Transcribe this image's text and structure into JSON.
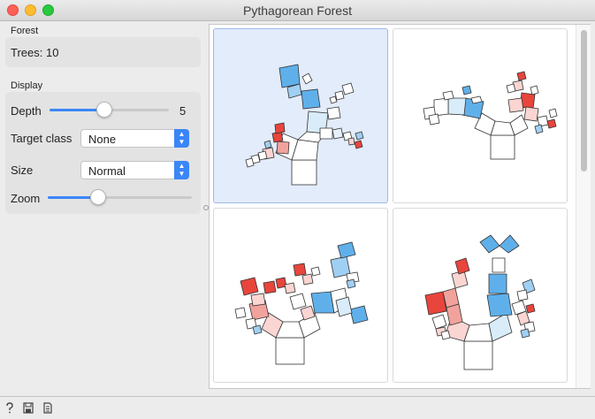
{
  "window": {
    "title": "Pythagorean Forest"
  },
  "forest": {
    "section_label": "Forest",
    "trees_text": "Trees: 10"
  },
  "display": {
    "section_label": "Display",
    "depth": {
      "label": "Depth",
      "value": "5",
      "fraction": 0.5
    },
    "target_class": {
      "label": "Target class",
      "selected": "None"
    },
    "size": {
      "label": "Size",
      "selected": "Normal"
    },
    "zoom": {
      "label": "Zoom",
      "fraction": 0.35
    }
  },
  "trees": [
    {
      "selected": true
    },
    {
      "selected": false
    },
    {
      "selected": false
    },
    {
      "selected": false
    }
  ],
  "statusbar": {
    "icons": [
      "help-icon",
      "save-icon",
      "report-icon"
    ]
  },
  "colors": {
    "accent": "#3b86f7",
    "red": "#e8453c",
    "blue": "#5fb0ea",
    "selection": "#e3ecfb"
  }
}
